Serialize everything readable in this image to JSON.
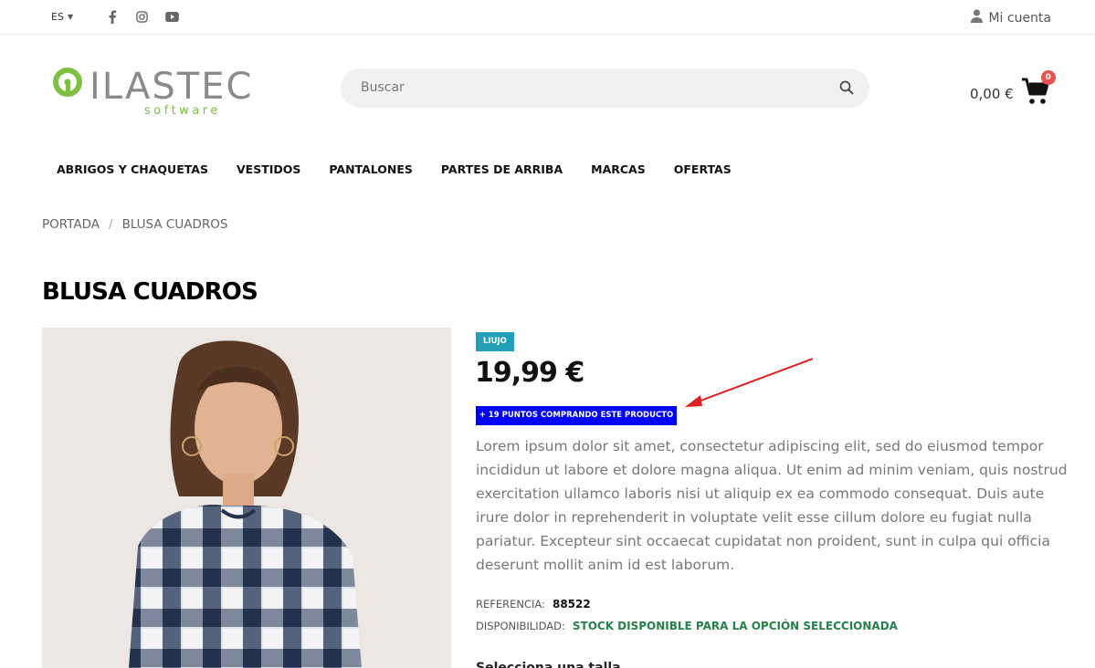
{
  "topbar": {
    "language": "ES",
    "account_label": "Mi cuenta",
    "social_icons": [
      "facebook-icon",
      "instagram-icon",
      "youtube-icon"
    ]
  },
  "header": {
    "logo_main": "iLASTEC",
    "logo_sub": "software",
    "search_placeholder": "Buscar",
    "cart_amount": "0,00 €",
    "cart_count": "0"
  },
  "nav": {
    "items": [
      {
        "label": "ABRIGOS Y CHAQUETAS"
      },
      {
        "label": "VESTIDOS"
      },
      {
        "label": "PANTALONES"
      },
      {
        "label": "PARTES DE ARRIBA"
      },
      {
        "label": "MARCAS"
      },
      {
        "label": "OFERTAS"
      }
    ]
  },
  "breadcrumb": {
    "home": "PORTADA",
    "current": "BLUSA CUADROS"
  },
  "product": {
    "title": "BLUSA CUADROS",
    "brand": "LIUJO",
    "price": "19,99 €",
    "points": "+ 19 PUNTOS COMPRANDO ESTE PRODUCTO",
    "description": "Lorem ipsum dolor sit amet, consectetur adipiscing elit, sed do eiusmod tempor incididun ut labore et dolore magna aliqua. Ut enim ad minim veniam, quis nostrud exercitation ullamco laboris nisi ut aliquip ex ea commodo consequat. Duis aute irure dolor in reprehenderit in voluptate velit esse cillum dolore eu fugiat nulla pariatur. Excepteur sint occaecat cupidatat non proident, sunt in culpa qui officia deserunt mollit anim id est laborum.",
    "reference_label": "REFERENCIA:",
    "reference_value": "88522",
    "availability_label": "DISPONIBILIDAD:",
    "availability_value": "STOCK DISPONIBLE PARA LA OPCIÓN SELECCIONADA",
    "cut_heading": "Selecciona una talla"
  },
  "colors": {
    "brand_badge": "#23a0b8",
    "points_badge": "#0000ff",
    "stock_green": "#24824a",
    "cart_badge": "#e9534f",
    "annotation_arrow": "#e02020",
    "logo_green": "#7cc142",
    "logo_gray": "#8a8a8a"
  }
}
